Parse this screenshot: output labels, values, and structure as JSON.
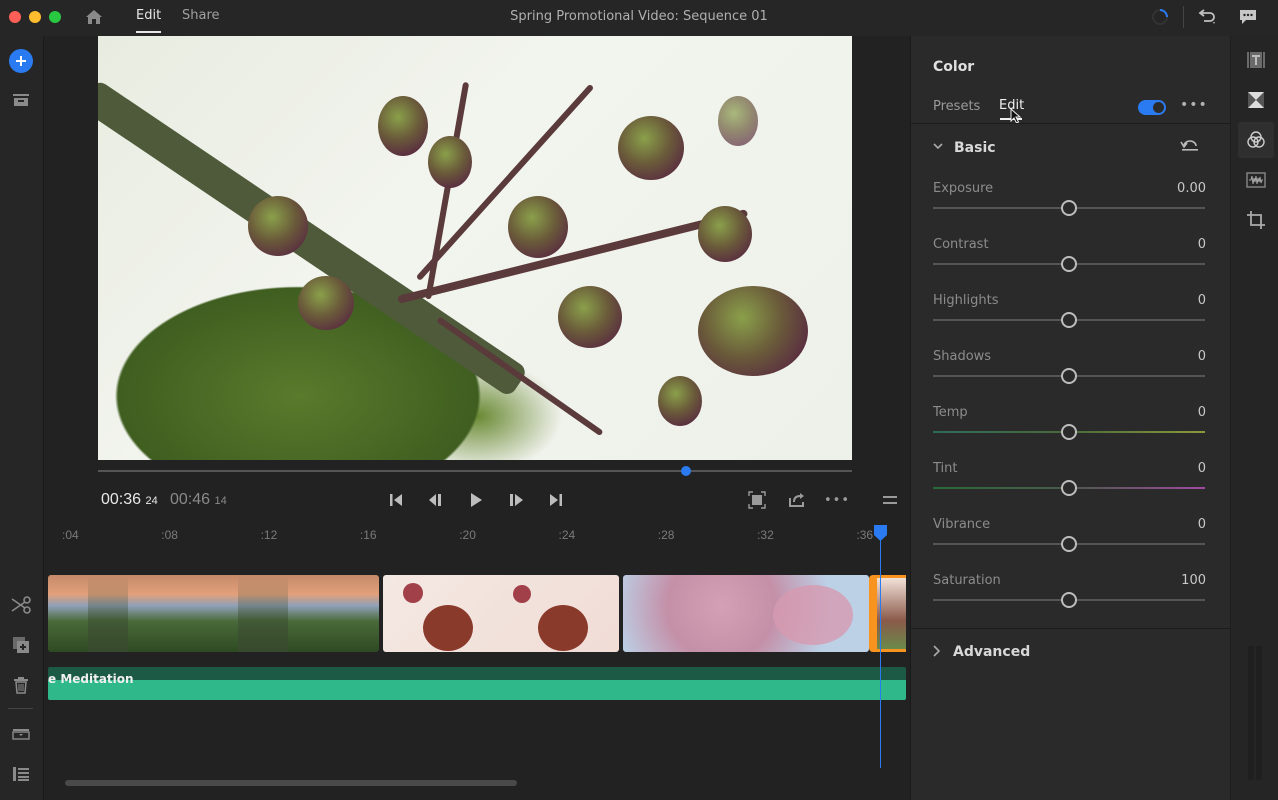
{
  "window": {
    "title": "Spring Promotional Video: Sequence 01",
    "traffic_lights": {
      "close": "#ff5f57",
      "minimize": "#febc2e",
      "maximize": "#28c840"
    }
  },
  "header": {
    "home_icon": "home-icon",
    "tabs": [
      {
        "label": "Edit",
        "active": true
      },
      {
        "label": "Share",
        "active": false
      }
    ],
    "right_icons": [
      "progress-spinner-icon",
      "undo-icon",
      "comments-icon"
    ]
  },
  "left_toolbar": {
    "top": [
      "add-media-icon",
      "project-bin-icon"
    ],
    "bottom": [
      "split-scissors-icon",
      "duplicate-icon",
      "delete-icon",
      "track-options-icon",
      "timeline-list-icon"
    ]
  },
  "player": {
    "current_time": "00:36",
    "current_frames": "24",
    "total_time": "00:46",
    "total_frames": "14",
    "scrub_progress": 0.78,
    "controls": [
      "skip-to-start-icon",
      "step-back-icon",
      "play-icon",
      "step-forward-icon",
      "skip-to-end-icon"
    ],
    "right_controls": [
      "fullscreen-icon",
      "share-export-icon",
      "more-icon",
      "menu-icon"
    ],
    "more_label": "•••"
  },
  "timeline": {
    "ruler_ticks": [
      ":04",
      ":08",
      ":12",
      ":16",
      ":20",
      ":24",
      ":28",
      ":32",
      ":36"
    ],
    "clips": [
      {
        "name": "mountain-sunset",
        "selected": false
      },
      {
        "name": "red-buds",
        "selected": false
      },
      {
        "name": "cherry-blossoms",
        "selected": false
      },
      {
        "name": "branch-clip",
        "selected": true
      }
    ],
    "audio_track_label": "e Meditation",
    "accent": "#2a7bf2",
    "audio_color": "#2fb88a",
    "selected_clip_color": "#f7931e"
  },
  "color_panel": {
    "title": "Color",
    "tabs": [
      {
        "label": "Presets",
        "active": false
      },
      {
        "label": "Edit",
        "active": true
      }
    ],
    "enabled": true,
    "more_label": "•••",
    "basic": {
      "label": "Basic",
      "expanded": true,
      "sliders": [
        {
          "label": "Exposure",
          "value": "0.00",
          "position": 0.5
        },
        {
          "label": "Contrast",
          "value": "0",
          "position": 0.5
        },
        {
          "label": "Highlights",
          "value": "0",
          "position": 0.5
        },
        {
          "label": "Shadows",
          "value": "0",
          "position": 0.5
        },
        {
          "label": "Temp",
          "value": "0",
          "position": 0.5
        },
        {
          "label": "Tint",
          "value": "0",
          "position": 0.5
        },
        {
          "label": "Vibrance",
          "value": "0",
          "position": 0.5
        },
        {
          "label": "Saturation",
          "value": "100",
          "position": 0.5
        }
      ]
    },
    "advanced": {
      "label": "Advanced",
      "expanded": false
    }
  },
  "right_toolbar": [
    "titles-icon",
    "transitions-icon",
    "color-icon",
    "audio-icon",
    "crop-icon"
  ]
}
